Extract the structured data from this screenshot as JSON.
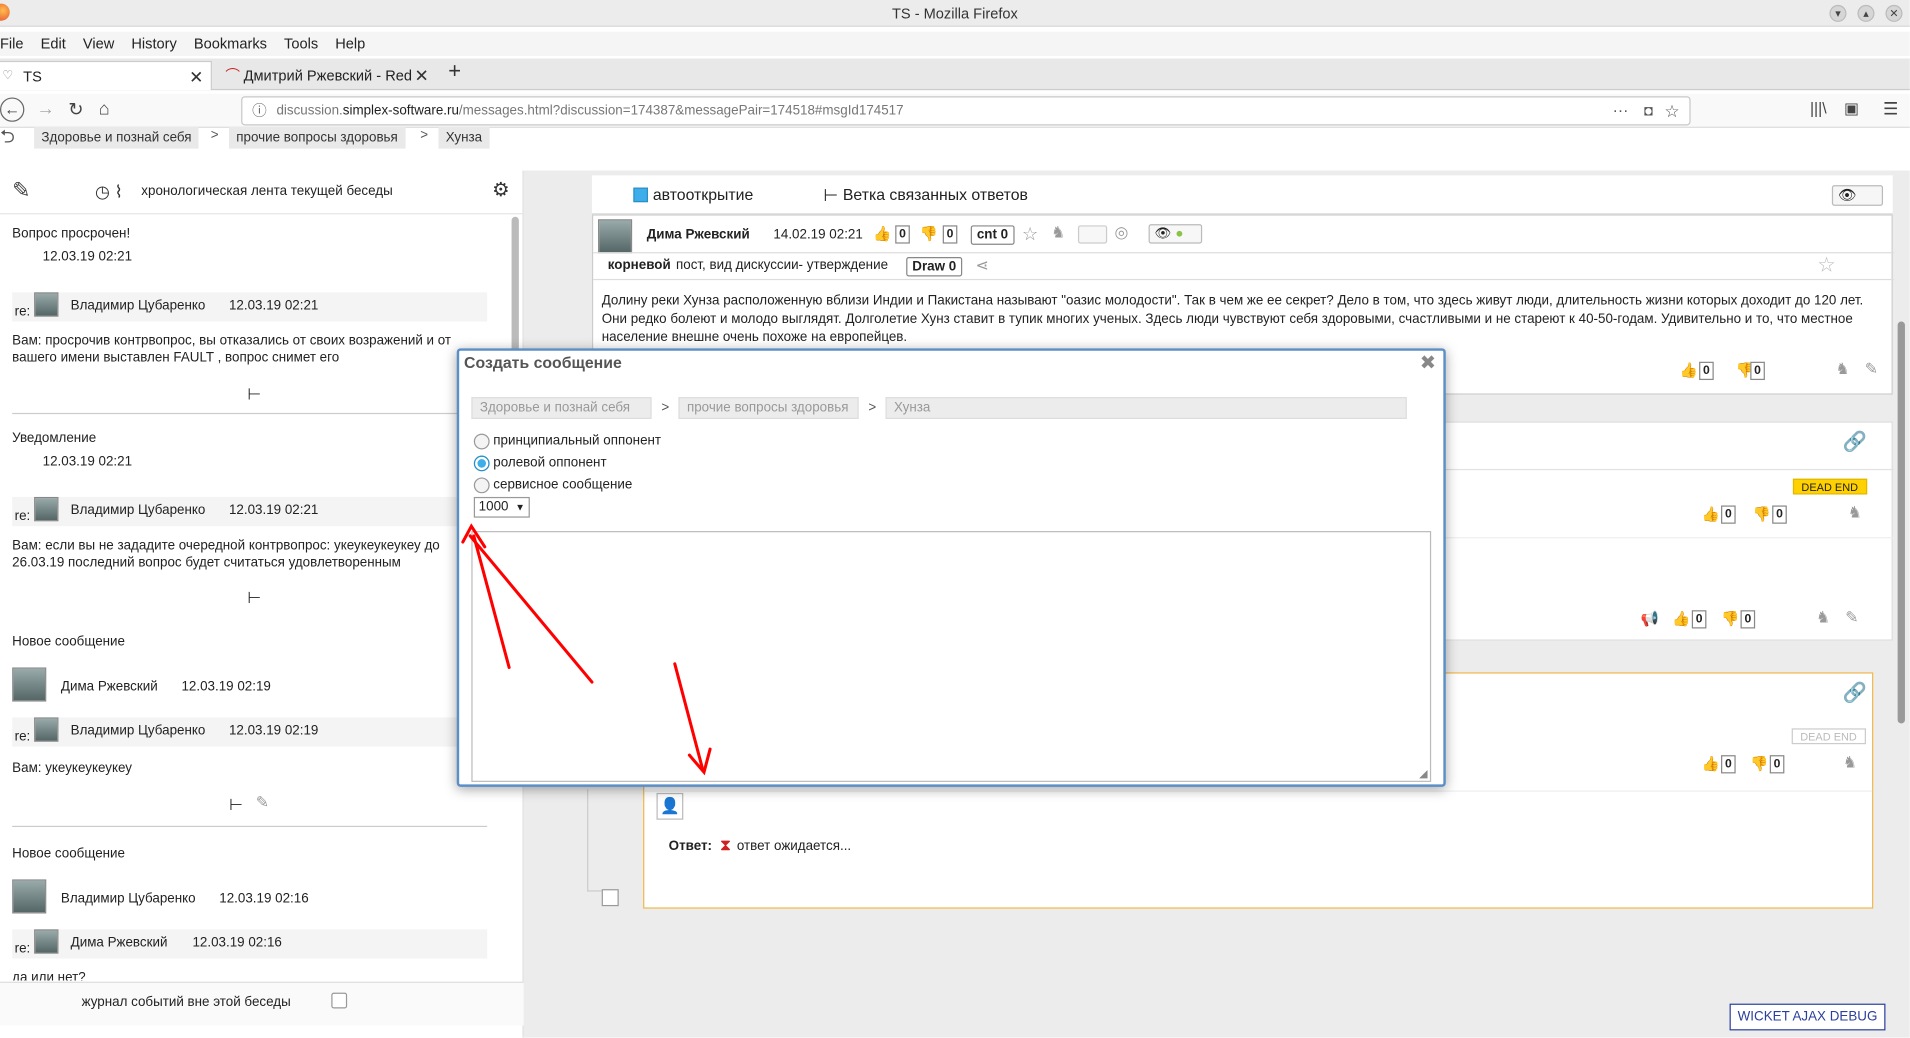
{
  "window": {
    "title": "TS - Mozilla Firefox"
  },
  "menu": [
    "File",
    "Edit",
    "View",
    "History",
    "Bookmarks",
    "Tools",
    "Help"
  ],
  "tabs": [
    {
      "label": "TS",
      "active": true
    },
    {
      "label": "Дмитрий Ржевский - Red",
      "active": false
    }
  ],
  "url": {
    "host": "discussion.",
    "domain": "simplex-software.ru",
    "path": "/messages.html?discussion=174387&messagePair=174518#msgId174517"
  },
  "breadcrumb": [
    "Здоровье и познай себя",
    "прочие вопросы здоровья",
    "Хунза"
  ],
  "breadcrumb_sep": ">",
  "left_panel": {
    "header": "хронологическая лента текущей беседы",
    "events": [
      {
        "title": "Вопрос просрочен!",
        "time": "12.03.19 02:21",
        "re": "re:",
        "author": "Владимир Цубаренко",
        "author_time": "12.03.19 02:21",
        "text": "Вам: просрочив контрвопрос, вы отказались от своих возражений и от вашего имени выставлен FAULT , вопрос снимет его"
      },
      {
        "title": "Уведомление",
        "time": "12.03.19 02:21",
        "re": "re:",
        "author": "Владимир Цубаренко",
        "author_time": "12.03.19 02:21",
        "text": "Вам: если вы не зададите очередной контрвопрос: укеукеукеукеу до 26.03.19 последний вопрос будет считаться удовлетворенным"
      },
      {
        "title": "Новое сообщение",
        "sender": "Дима Ржевский",
        "sender_time": "12.03.19 02:19",
        "re": "re:",
        "author": "Владимир Цубаренко",
        "author_time": "12.03.19 02:19",
        "text": "Вам: укеукеукеукеу"
      },
      {
        "title": "Новое сообщение",
        "sender": "Владимир Цубаренко",
        "sender_time": "12.03.19 02:16",
        "re": "re:",
        "author": "Дима Ржевский",
        "author_time": "12.03.19 02:16",
        "text": "да или нет?"
      }
    ],
    "footer": "журнал событий вне этой беседы"
  },
  "toolbar": {
    "autoopen": "автооткрытие",
    "branch": "Ветка связанных ответов"
  },
  "post": {
    "author": "Дима Ржевский",
    "time": "14.02.19 02:21",
    "likes": "0",
    "dislikes": "0",
    "cnt": "cnt 0",
    "kind_bold": "корневой",
    "kind_rest": "пост, вид дискуссии- утверждение",
    "draw": "Draw 0",
    "text": "Долину реки Хунза расположенную вблизи Индии и Пакистана называют \"оазис молодости\". Так в чем же ее секрет? Дело в том, что здесь живут люди, длительность жизни которых доходит до 120 лет. Они редко болеют и молодо выглядят. Долголетие Хунз ставит в тупик многих ученых. Здесь люди чувствуют себя здоровыми, счастливыми и не стареют к 40-50-годам. Удивительно и то, что местное население внешне очень похоже на европейцев.",
    "bottom_likes": "0",
    "bottom_dislikes": "0"
  },
  "card1": {
    "badge": "DEAD END",
    "likes": "0",
    "dislikes": "0",
    "likes2": "0",
    "dislikes2": "0"
  },
  "card2": {
    "badge": "DEAD END",
    "likes": "0",
    "dislikes": "0",
    "answer_label": "Ответ:",
    "answer_text": "ответ ожидается..."
  },
  "dialog": {
    "title": "Создать сообщение",
    "crumbs": [
      "Здоровье и познай себя",
      "прочие вопросы здоровья",
      "Хунза"
    ],
    "options": [
      {
        "label": "принципиальный оппонент",
        "selected": false
      },
      {
        "label": "ролевой оппонент",
        "selected": true
      },
      {
        "label": "сервисное сообщение",
        "selected": false
      }
    ],
    "limit": "1000"
  },
  "debug": "WICKET AJAX DEBUG",
  "colors": {
    "accent": "#3daee9",
    "dialog_border": "#5b8fc7",
    "deadend": "#ffd100",
    "arrow": "#ff0000",
    "card_border": "#f0b64b"
  }
}
